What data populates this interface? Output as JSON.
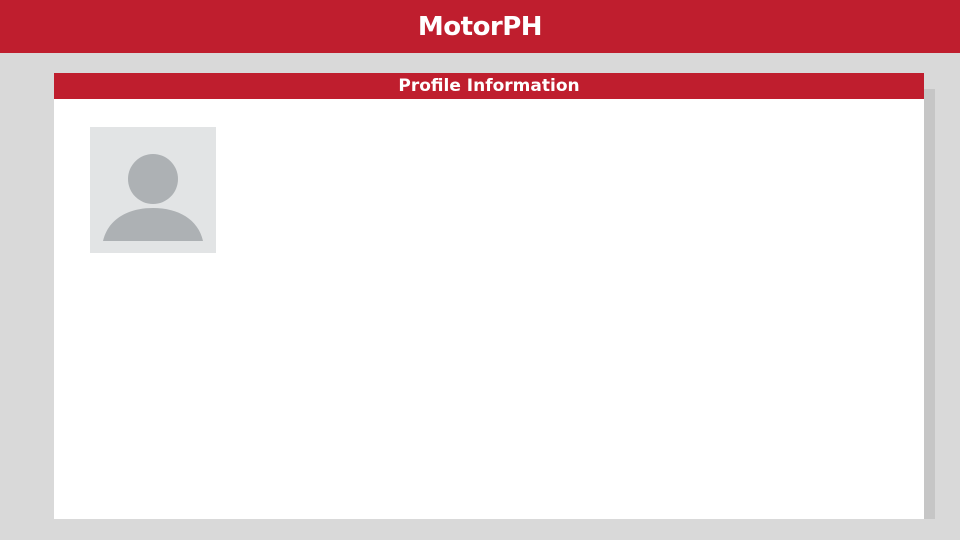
{
  "app": {
    "title": "MotorPH"
  },
  "profile": {
    "section_title": "Profile Information",
    "avatar_icon": "user-placeholder-icon"
  },
  "colors": {
    "brand_red": "#bf1e2e",
    "page_background": "#d9d9d9",
    "card_background": "#ffffff",
    "avatar_background": "#e2e4e5",
    "avatar_silhouette": "#adb1b4"
  }
}
